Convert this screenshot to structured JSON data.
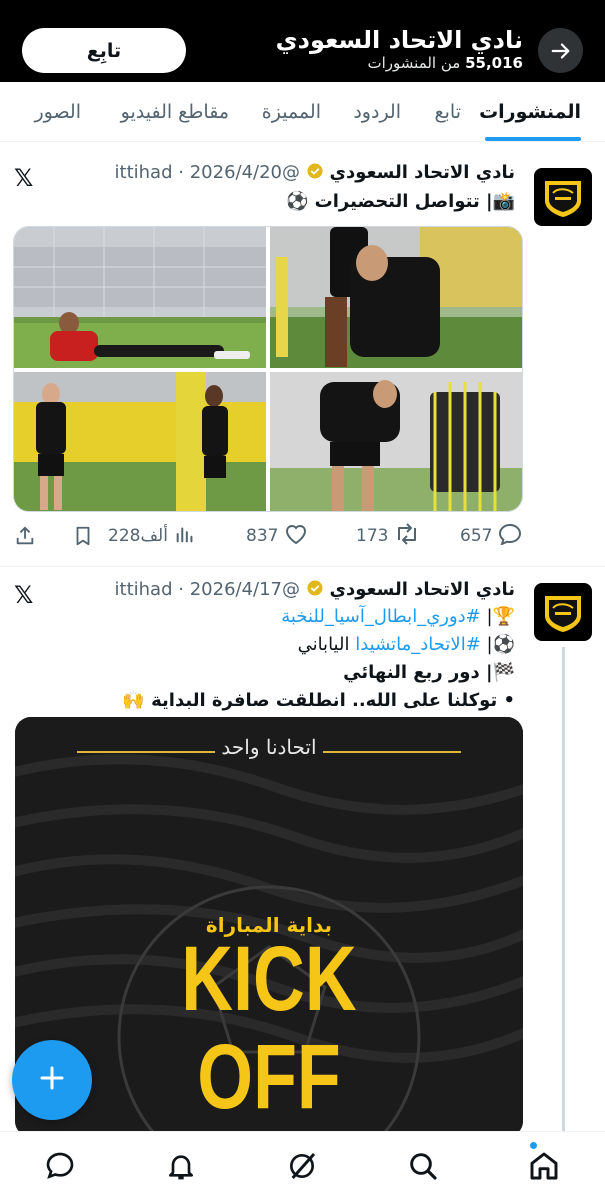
{
  "header": {
    "title": "نادي الاتحاد السعودي",
    "posts_count": "55,016",
    "posts_label": "من المنشورات",
    "follow_label": "تابِع"
  },
  "tabs": [
    {
      "label": "المنشورات",
      "active": true
    },
    {
      "label": "تابع"
    },
    {
      "label": "الردود"
    },
    {
      "label": "المميزة"
    },
    {
      "label": "مقاطع الفيديو"
    },
    {
      "label": "الصور"
    }
  ],
  "posts": [
    {
      "name": "نادي الاتحاد السعودي",
      "handle": "@ittihad",
      "date": "2026/4/20",
      "text": "📸| تتواصل التحضيرات ⚽",
      "stats": {
        "views": "228ألف",
        "likes": "837",
        "reposts": "173",
        "replies": "657"
      }
    },
    {
      "name": "نادي الاتحاد السعودي",
      "handle": "@ittihad",
      "date": "2026/4/17",
      "line1_emoji": "🏆|",
      "line1_hash": "#دوري_ابطال_آسيا_للنخبة",
      "line2_emoji": "⚽|",
      "line2_hash": "#الاتحاد_ماتشيدا",
      "line2_rest": " الياباني",
      "line3": "🏁| دور ربع النهائي",
      "line4": "• توكلنا على الله..  انطلقت صافرة البداية 🙌",
      "promo": {
        "slogan": "اتحادنا واحد",
        "subtitle": "بداية المباراة",
        "line1": "KICK",
        "line2": "OFF"
      }
    }
  ],
  "avatar_caption": "ITTIHAD CLUB",
  "colors": {
    "accent": "#1d9bf0",
    "club_yellow": "#f5c518",
    "header_bg": "#000000"
  },
  "icons": [
    "back-arrow-icon",
    "verified-badge-icon",
    "x-logo-icon",
    "share-icon",
    "bookmark-icon",
    "views-icon",
    "heart-icon",
    "repost-icon",
    "reply-icon",
    "compose-plus-icon",
    "messages-icon",
    "notifications-icon",
    "grok-icon",
    "search-icon",
    "home-icon"
  ]
}
